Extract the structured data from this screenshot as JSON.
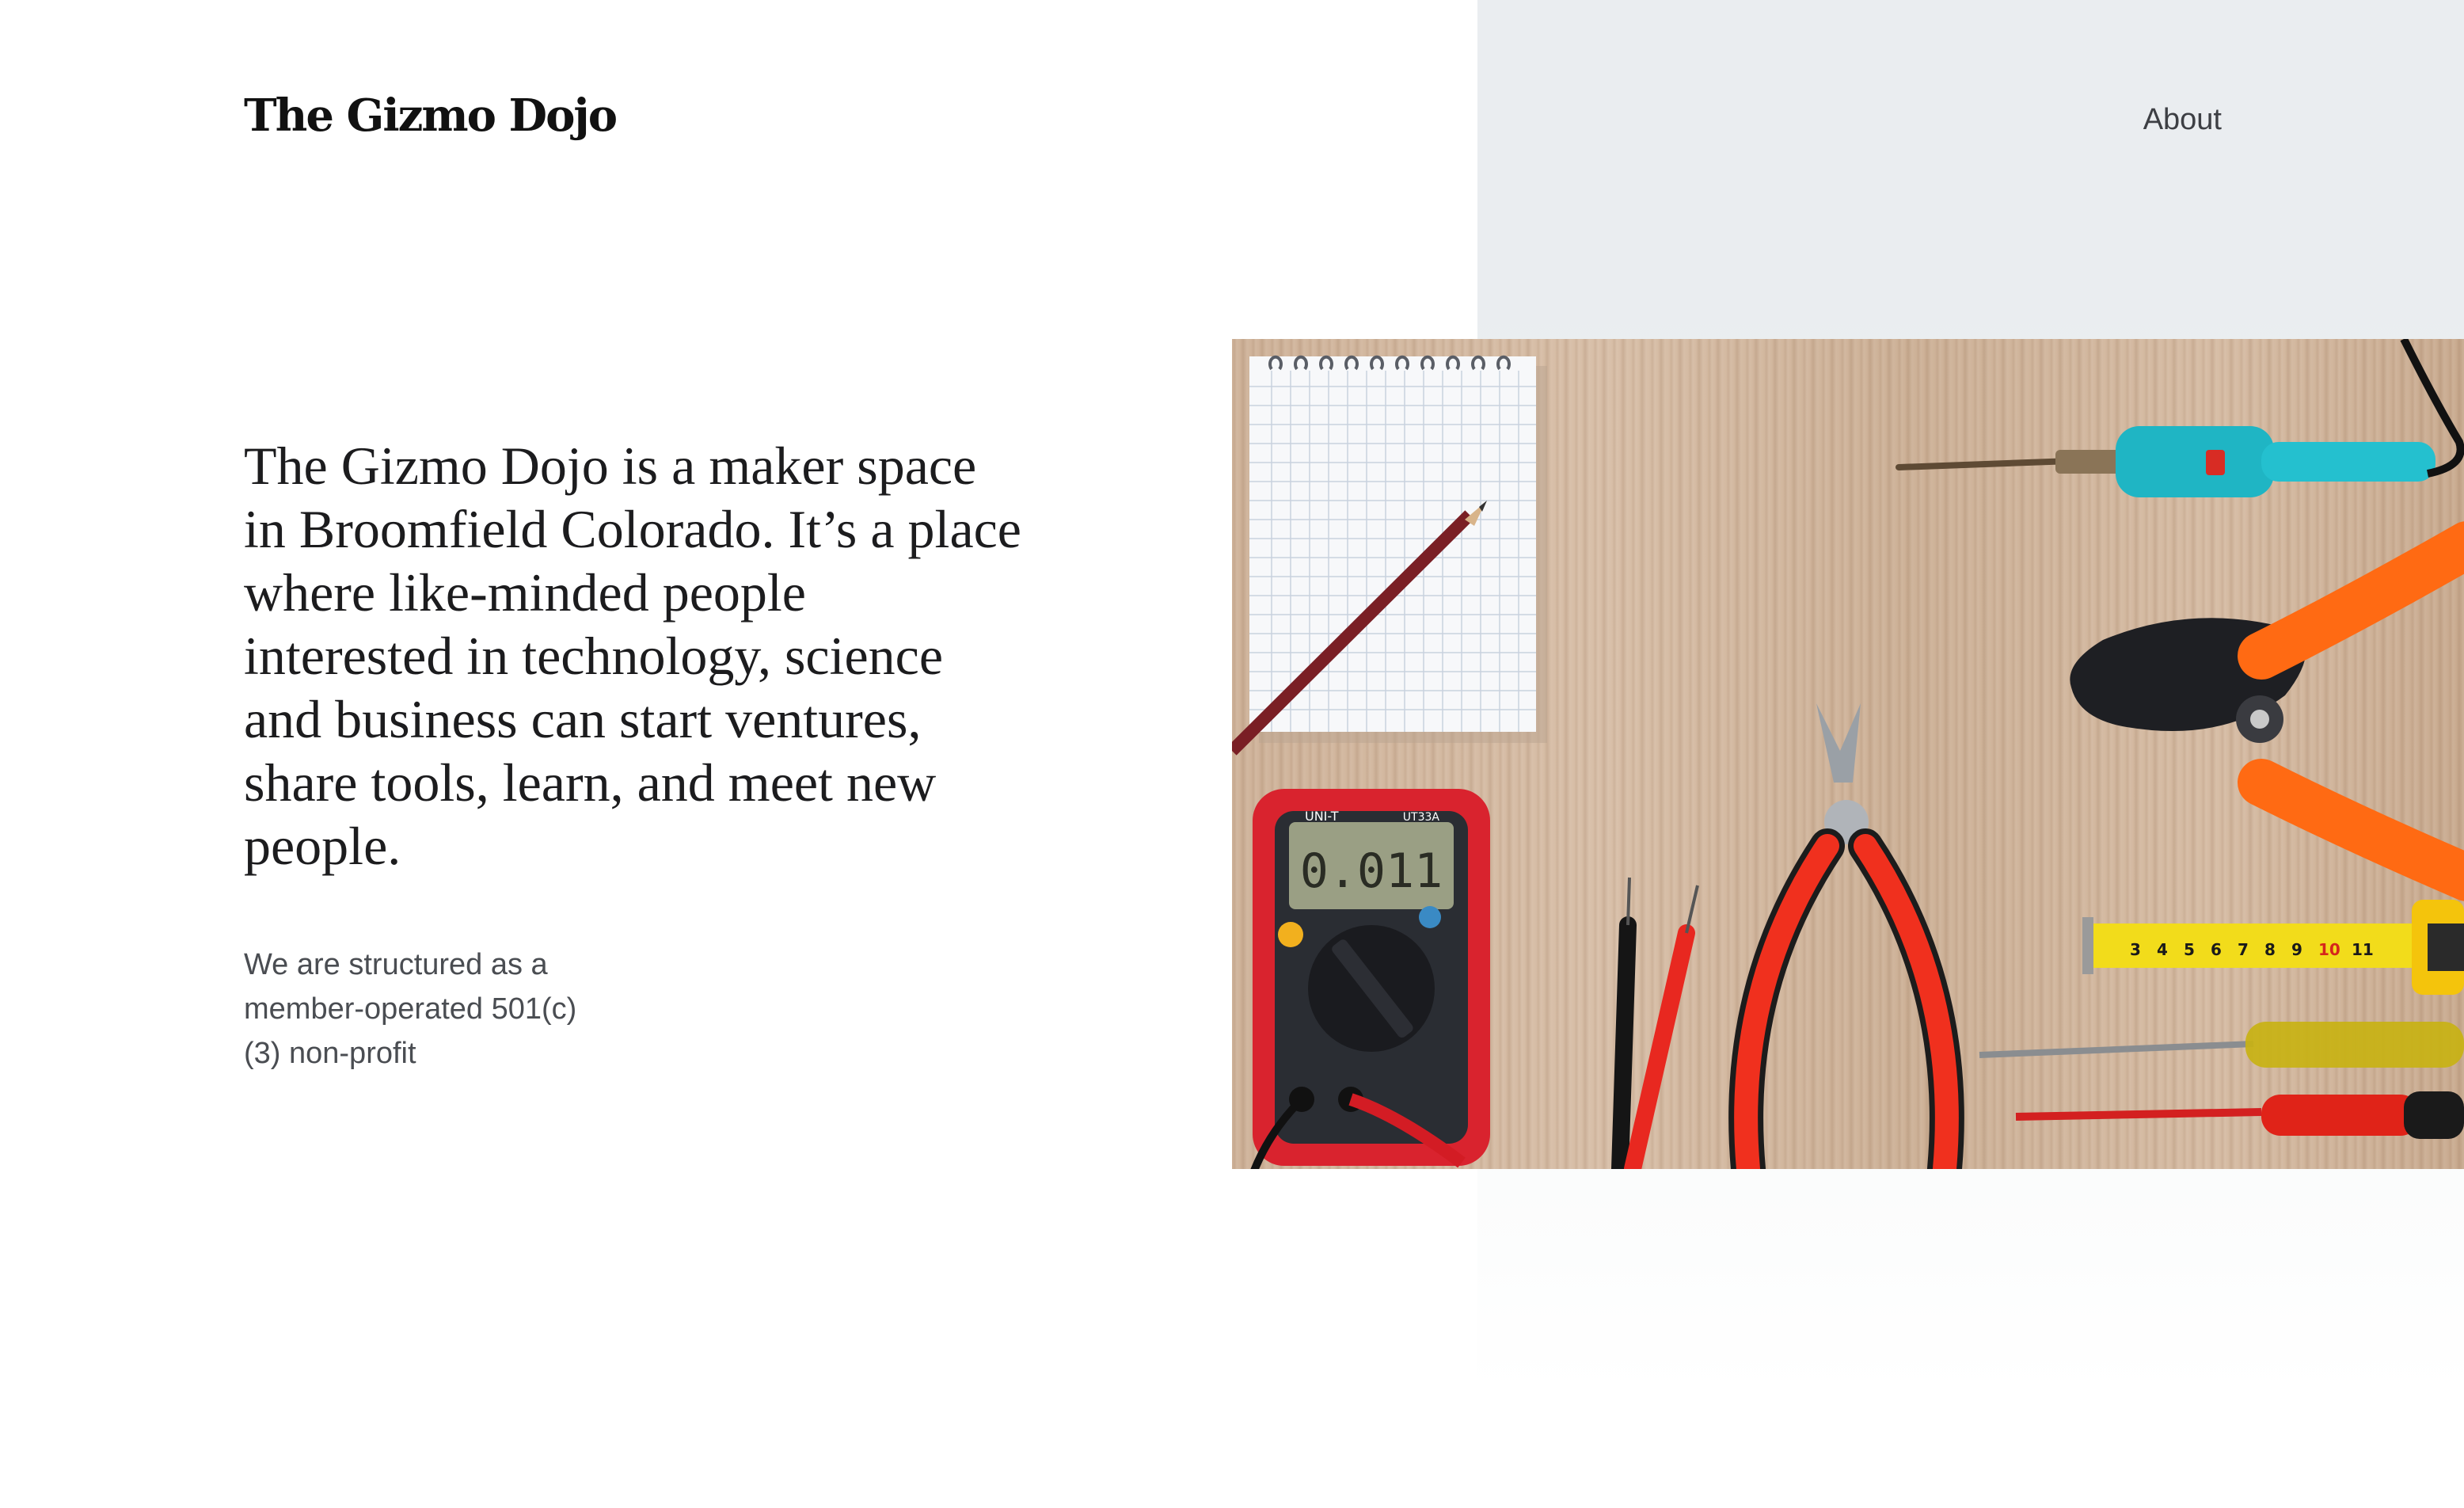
{
  "header": {
    "brand": "The Gizmo Dojo",
    "nav": [
      {
        "label": "About"
      }
    ]
  },
  "main": {
    "intro": "The Gizmo Dojo is a maker space in Broomfield Colorado. It’s a place where like-minded people interested in technology, science and business can start ventures, share tools, learn, and meet new people.",
    "sub": "We are structured as a member-operated 501(c)(3) non-profit"
  },
  "hero_image": {
    "subject": "workbench-tools-photo",
    "multimeter_display": "0.011",
    "multimeter_brand": "UNI-T",
    "multimeter_model": "UT33A",
    "tape_numbers": [
      "3",
      "4",
      "5",
      "6",
      "7",
      "8",
      "9",
      "10",
      "11"
    ]
  },
  "colors": {
    "text_dark": "#1c1c1e",
    "text_muted": "#4a4d52",
    "panel_bg": "#eaedf0",
    "multimeter_red": "#d9232e",
    "handle_orange": "#ff6a13",
    "handle_teal": "#1fb5c4",
    "tape_yellow": "#f2dc1b"
  }
}
